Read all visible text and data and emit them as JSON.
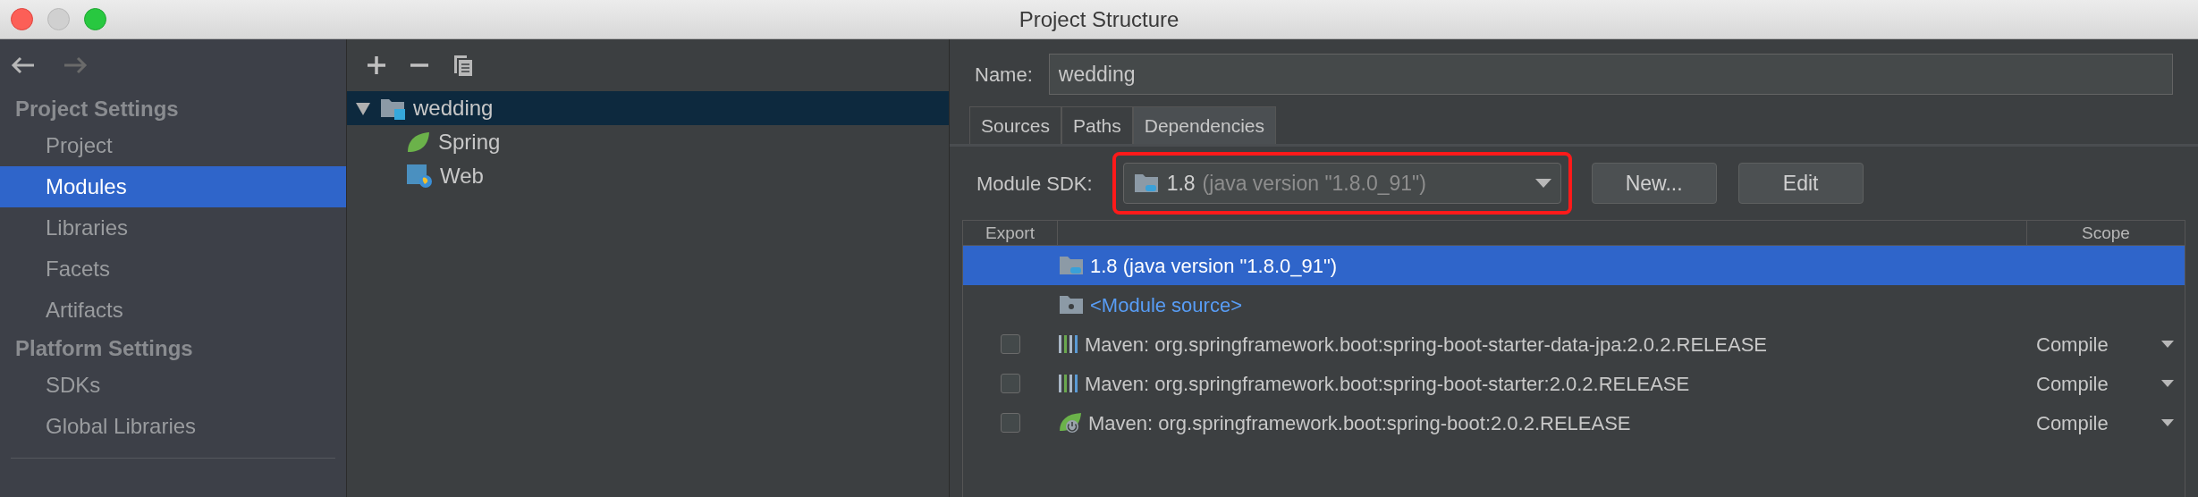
{
  "window": {
    "title": "Project Structure"
  },
  "sidebar": {
    "sections": [
      {
        "title": "Project Settings",
        "items": [
          {
            "label": "Project",
            "selected": false
          },
          {
            "label": "Modules",
            "selected": true
          },
          {
            "label": "Libraries",
            "selected": false
          },
          {
            "label": "Facets",
            "selected": false
          },
          {
            "label": "Artifacts",
            "selected": false
          }
        ]
      },
      {
        "title": "Platform Settings",
        "items": [
          {
            "label": "SDKs",
            "selected": false
          },
          {
            "label": "Global Libraries",
            "selected": false
          }
        ]
      }
    ]
  },
  "tree": [
    {
      "label": "wedding",
      "kind": "module",
      "selected": true,
      "expanded": true,
      "children": [
        {
          "label": "Spring",
          "kind": "spring",
          "selected": false
        },
        {
          "label": "Web",
          "kind": "web",
          "selected": false
        }
      ]
    }
  ],
  "name_field": {
    "label": "Name:",
    "value": "wedding"
  },
  "tabs": [
    {
      "label": "Sources",
      "selected": false
    },
    {
      "label": "Paths",
      "selected": false
    },
    {
      "label": "Dependencies",
      "selected": true
    }
  ],
  "module_sdk": {
    "label": "Module SDK:",
    "value": "1.8",
    "detail": "(java version \"1.8.0_91\")",
    "buttons": [
      "New...",
      "Edit"
    ]
  },
  "table": {
    "columns": [
      "Export",
      "Scope"
    ],
    "rows": [
      {
        "kind": "sdk",
        "name": "1.8 (java version \"1.8.0_91\")",
        "selected": true
      },
      {
        "kind": "source",
        "name": "<Module source>",
        "selected": false
      },
      {
        "kind": "maven",
        "name": "Maven: org.springframework.boot:spring-boot-starter-data-jpa:2.0.2.RELEASE",
        "checked": false,
        "scope": "Compile",
        "selected": false
      },
      {
        "kind": "maven",
        "name": "Maven: org.springframework.boot:spring-boot-starter:2.0.2.RELEASE",
        "checked": false,
        "scope": "Compile",
        "selected": false
      },
      {
        "kind": "spring",
        "name": "Maven: org.springframework.boot:spring-boot:2.0.2.RELEASE",
        "checked": false,
        "scope": "Compile",
        "selected": false
      }
    ]
  }
}
